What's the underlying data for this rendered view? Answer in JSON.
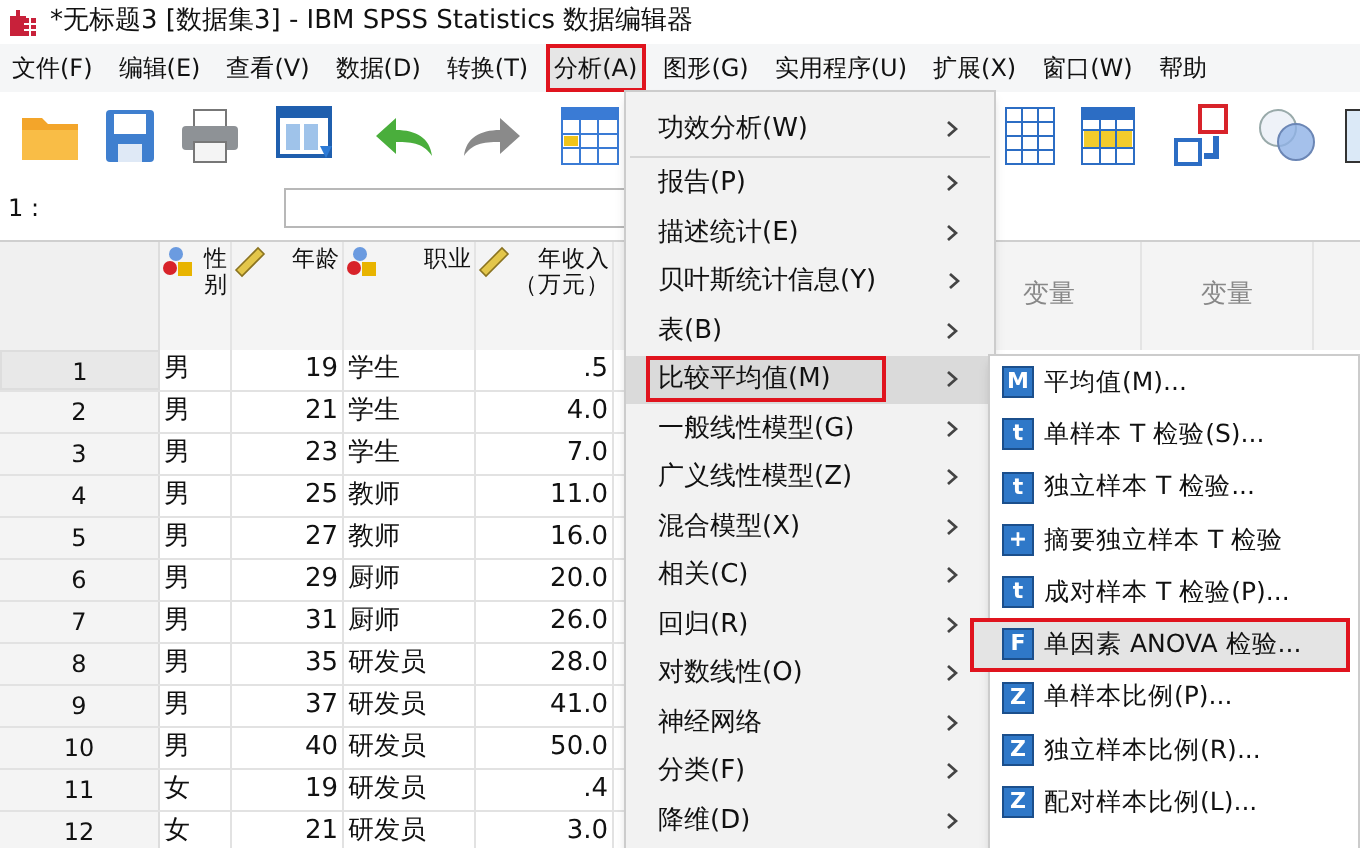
{
  "window": {
    "title": "*无标题3 [数据集3] - IBM SPSS Statistics 数据编辑器"
  },
  "menubar": [
    {
      "label": "文件(F)",
      "selected": false
    },
    {
      "label": "编辑(E)",
      "selected": false
    },
    {
      "label": "查看(V)",
      "selected": false
    },
    {
      "label": "数据(D)",
      "selected": false
    },
    {
      "label": "转换(T)",
      "selected": false
    },
    {
      "label": "分析(A)",
      "selected": true
    },
    {
      "label": "图形(G)",
      "selected": false
    },
    {
      "label": "实用程序(U)",
      "selected": false
    },
    {
      "label": "扩展(X)",
      "selected": false
    },
    {
      "label": "窗口(W)",
      "selected": false
    },
    {
      "label": "帮助",
      "selected": false
    }
  ],
  "cell_ref": {
    "label": "1 :"
  },
  "table": {
    "columns": [
      {
        "label": "性别",
        "kind": "nominal"
      },
      {
        "label": "年龄",
        "kind": "scale"
      },
      {
        "label": "职业",
        "kind": "nominal"
      },
      {
        "label": "年收入（万元）",
        "kind": "scale"
      }
    ],
    "empty_columns": [
      "变量",
      "变量"
    ],
    "rows": [
      {
        "num": "1",
        "selected": true,
        "cells": [
          "男",
          "19",
          "学生",
          ".5"
        ]
      },
      {
        "num": "2",
        "selected": false,
        "cells": [
          "男",
          "21",
          "学生",
          "4.0"
        ]
      },
      {
        "num": "3",
        "selected": false,
        "cells": [
          "男",
          "23",
          "学生",
          "7.0"
        ]
      },
      {
        "num": "4",
        "selected": false,
        "cells": [
          "男",
          "25",
          "教师",
          "11.0"
        ]
      },
      {
        "num": "5",
        "selected": false,
        "cells": [
          "男",
          "27",
          "教师",
          "16.0"
        ]
      },
      {
        "num": "6",
        "selected": false,
        "cells": [
          "男",
          "29",
          "厨师",
          "20.0"
        ]
      },
      {
        "num": "7",
        "selected": false,
        "cells": [
          "男",
          "31",
          "厨师",
          "26.0"
        ]
      },
      {
        "num": "8",
        "selected": false,
        "cells": [
          "男",
          "35",
          "研发员",
          "28.0"
        ]
      },
      {
        "num": "9",
        "selected": false,
        "cells": [
          "男",
          "37",
          "研发员",
          "41.0"
        ]
      },
      {
        "num": "10",
        "selected": false,
        "cells": [
          "男",
          "40",
          "研发员",
          "50.0"
        ]
      },
      {
        "num": "11",
        "selected": false,
        "cells": [
          "女",
          "19",
          "研发员",
          ".4"
        ]
      },
      {
        "num": "12",
        "selected": false,
        "cells": [
          "女",
          "21",
          "研发员",
          "3.0"
        ]
      }
    ]
  },
  "analyze_menu": [
    {
      "label": "功效分析(W)",
      "selected": false,
      "divider_after": true
    },
    {
      "label": "报告(P)",
      "selected": false,
      "divider_after": false
    },
    {
      "label": "描述统计(E)",
      "selected": false,
      "divider_after": false
    },
    {
      "label": "贝叶斯统计信息(Y)",
      "selected": false,
      "divider_after": false
    },
    {
      "label": "表(B)",
      "selected": false,
      "divider_after": false
    },
    {
      "label": "比较平均值(M)",
      "selected": true,
      "divider_after": false
    },
    {
      "label": "一般线性模型(G)",
      "selected": false,
      "divider_after": false
    },
    {
      "label": "广义线性模型(Z)",
      "selected": false,
      "divider_after": false
    },
    {
      "label": "混合模型(X)",
      "selected": false,
      "divider_after": false
    },
    {
      "label": "相关(C)",
      "selected": false,
      "divider_after": false
    },
    {
      "label": "回归(R)",
      "selected": false,
      "divider_after": false
    },
    {
      "label": "对数线性(O)",
      "selected": false,
      "divider_after": false
    },
    {
      "label": "神经网络",
      "selected": false,
      "divider_after": false
    },
    {
      "label": "分类(F)",
      "selected": false,
      "divider_after": false
    },
    {
      "label": "降维(D)",
      "selected": false,
      "divider_after": false
    }
  ],
  "compare_means_menu": [
    {
      "label": "平均值(M)...",
      "glyph": "M",
      "selected": false
    },
    {
      "label": "单样本 T 检验(S)...",
      "glyph": "t",
      "selected": false
    },
    {
      "label": "独立样本 T 检验...",
      "glyph": "t",
      "selected": false
    },
    {
      "label": "摘要独立样本 T 检验",
      "glyph": "+",
      "selected": false
    },
    {
      "label": "成对样本 T 检验(P)...",
      "glyph": "t",
      "selected": false
    },
    {
      "label": "单因素 ANOVA 检验...",
      "glyph": "F",
      "selected": true
    },
    {
      "label": "单样本比例(P)...",
      "glyph": "Z",
      "selected": false
    },
    {
      "label": "独立样本比例(R)...",
      "glyph": "Z",
      "selected": false
    },
    {
      "label": "配对样本比例(L)...",
      "glyph": "Z",
      "selected": false
    }
  ]
}
